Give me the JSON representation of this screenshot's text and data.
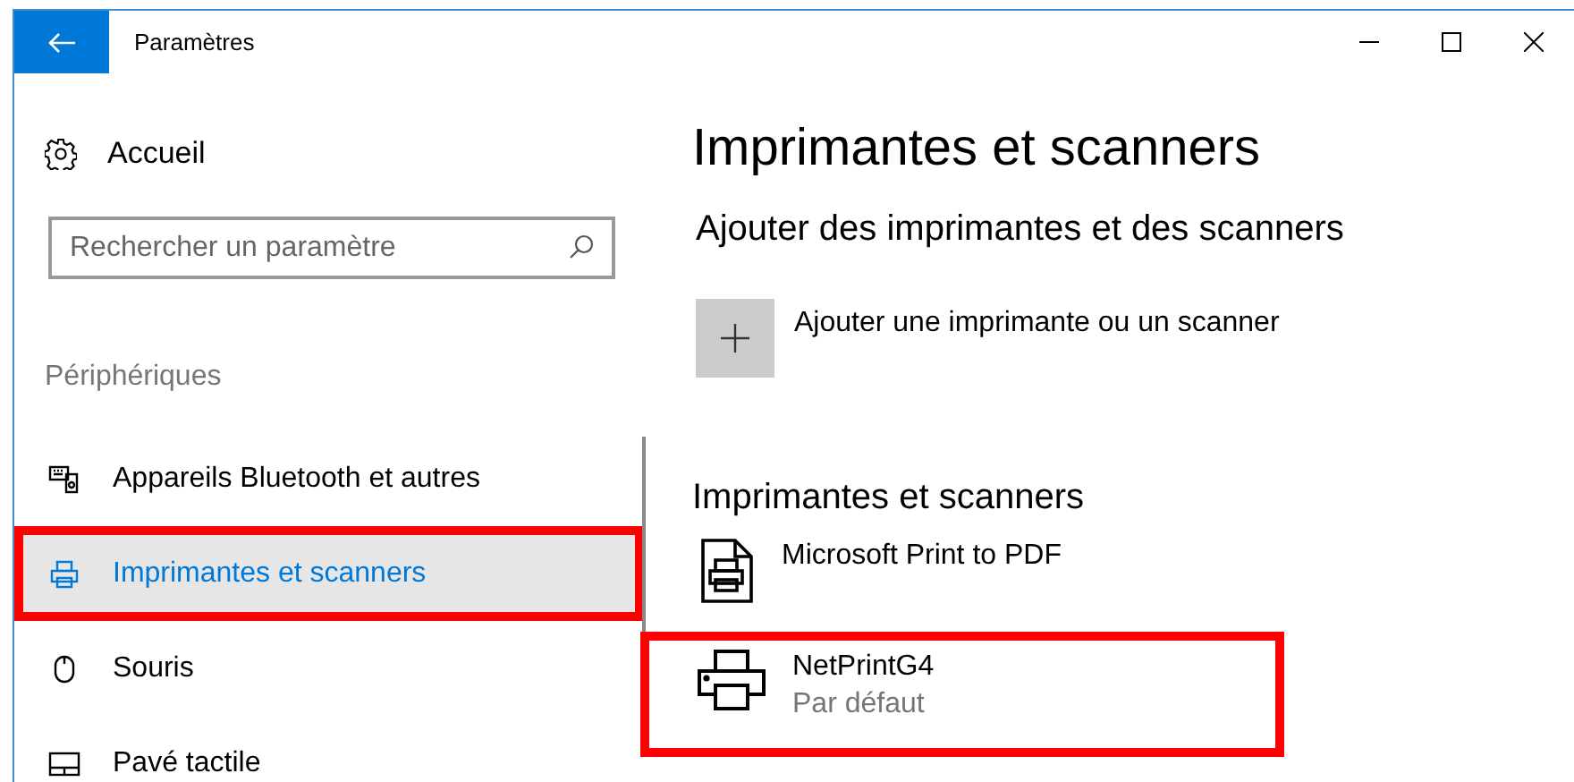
{
  "window": {
    "title": "Paramètres"
  },
  "sidebar": {
    "home": "Accueil",
    "search": {
      "placeholder": "Rechercher un paramètre"
    },
    "section": "Périphériques",
    "items": [
      {
        "label": "Appareils Bluetooth et autres",
        "kind": "keyboard",
        "selected": false,
        "annotated": false
      },
      {
        "label": "Imprimantes et scanners",
        "kind": "printer",
        "selected": true,
        "annotated": true
      },
      {
        "label": "Souris",
        "kind": "mouse",
        "selected": false,
        "annotated": false
      },
      {
        "label": "Pavé tactile",
        "kind": "touchpad",
        "selected": false,
        "annotated": false
      }
    ]
  },
  "main": {
    "title": "Imprimantes et scanners",
    "add_heading": "Ajouter des imprimantes et des scanners",
    "add_label": "Ajouter une imprimante ou un scanner",
    "list_heading": "Imprimantes et scanners",
    "printers": [
      {
        "name": "Microsoft Print to PDF",
        "kind": "pdf",
        "annotated": false
      },
      {
        "name": "NetPrintG4",
        "status": "Par défaut",
        "kind": "printer",
        "annotated": true
      }
    ]
  }
}
